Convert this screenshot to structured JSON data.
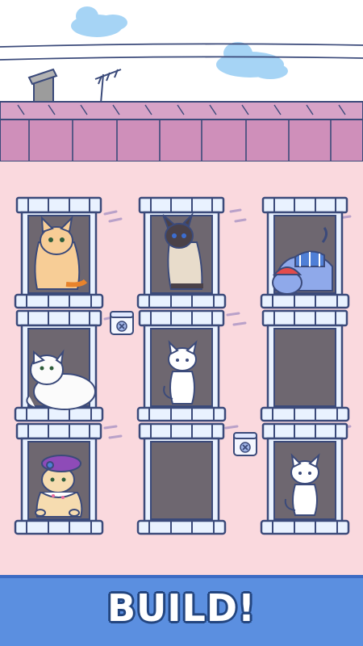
{
  "game": {
    "cta_label": "BUILD!"
  },
  "colors": {
    "sky": "#ffffff",
    "roof": "#cf8fba",
    "wall": "#fad9de",
    "window_frame": "#e9f2ff",
    "window_interior": "#6e6770",
    "outline": "#3b4a7a",
    "banner": "#5b8fe0"
  },
  "windows": [
    {
      "occupant": "orange-cat"
    },
    {
      "occupant": "siamese-cat"
    },
    {
      "occupant": "blue-striped-cat"
    },
    {
      "occupant": "fluffy-white-persian-cat"
    },
    {
      "occupant": "white-cat"
    },
    {
      "occupant": "empty"
    },
    {
      "occupant": "cat-with-purple-beret"
    },
    {
      "occupant": "empty"
    },
    {
      "occupant": "white-cat"
    }
  ],
  "locks": [
    {
      "icon": "locked-box-icon"
    },
    {
      "icon": "locked-box-icon"
    }
  ]
}
